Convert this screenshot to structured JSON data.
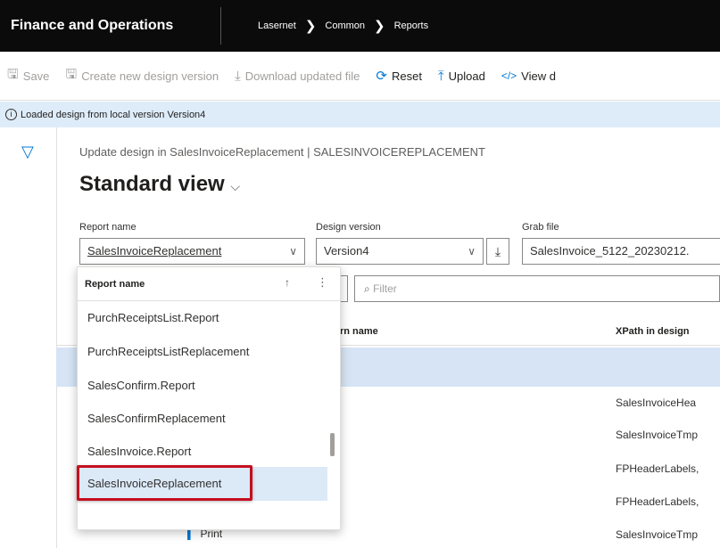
{
  "header": {
    "app_title": "Finance and Operations",
    "breadcrumb": [
      "Lasernet",
      "Common",
      "Reports"
    ]
  },
  "toolbar": {
    "save": "Save",
    "create_version": "Create new design version",
    "download": "Download updated file",
    "reset": "Reset",
    "upload": "Upload",
    "view": "View d"
  },
  "message": "Loaded design from local version Version4",
  "page": {
    "caption": "Update design in SalesInvoiceReplacement  |  SALESINVOICEREPLACEMENT",
    "view_title": "Standard view"
  },
  "fields": {
    "report_name_label": "Report name",
    "report_name_value": "SalesInvoiceReplacement",
    "design_version_label": "Design version",
    "design_version_value": "Version4",
    "grab_file_label": "Grab file",
    "grab_file_value": "SalesInvoice_5122_20230212."
  },
  "grid": {
    "filter_placeholder": "Filter",
    "col_name": "rn name",
    "col_xpath": "XPath in design",
    "xpath_values": [
      "SalesInvoiceHea",
      "SalesInvoiceTmp",
      "FPHeaderLabels,",
      "FPHeaderLabels,",
      "SalesInvoiceTmp"
    ],
    "print_label": "Print"
  },
  "dropdown": {
    "header": "Report name",
    "items": [
      "PurchReceiptsList.Report",
      "PurchReceiptsListReplacement",
      "SalesConfirm.Report",
      "SalesConfirmReplacement",
      "SalesInvoice.Report",
      "SalesInvoiceReplacement"
    ],
    "selected_index": 5
  }
}
